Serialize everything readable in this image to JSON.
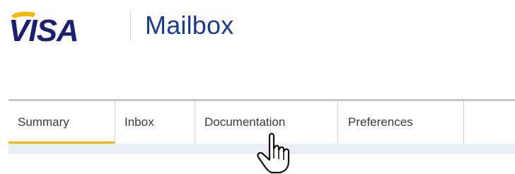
{
  "header": {
    "logo": {
      "icon": "visa-logo",
      "text": "VISA",
      "colors": {
        "primary": "#1a1f71",
        "accent": "#f7b600"
      }
    },
    "app_title": "Mailbox",
    "title_color": "#1a3c8c"
  },
  "nav": {
    "tabs": [
      {
        "label": "Summary",
        "active": true
      },
      {
        "label": "Inbox",
        "active": false
      },
      {
        "label": "Documentation",
        "active": false
      },
      {
        "label": "Preferences",
        "active": false
      }
    ],
    "active_underline_color": "#f7b600"
  },
  "cursor": {
    "icon": "hand-pointer-icon",
    "target": "Documentation"
  }
}
